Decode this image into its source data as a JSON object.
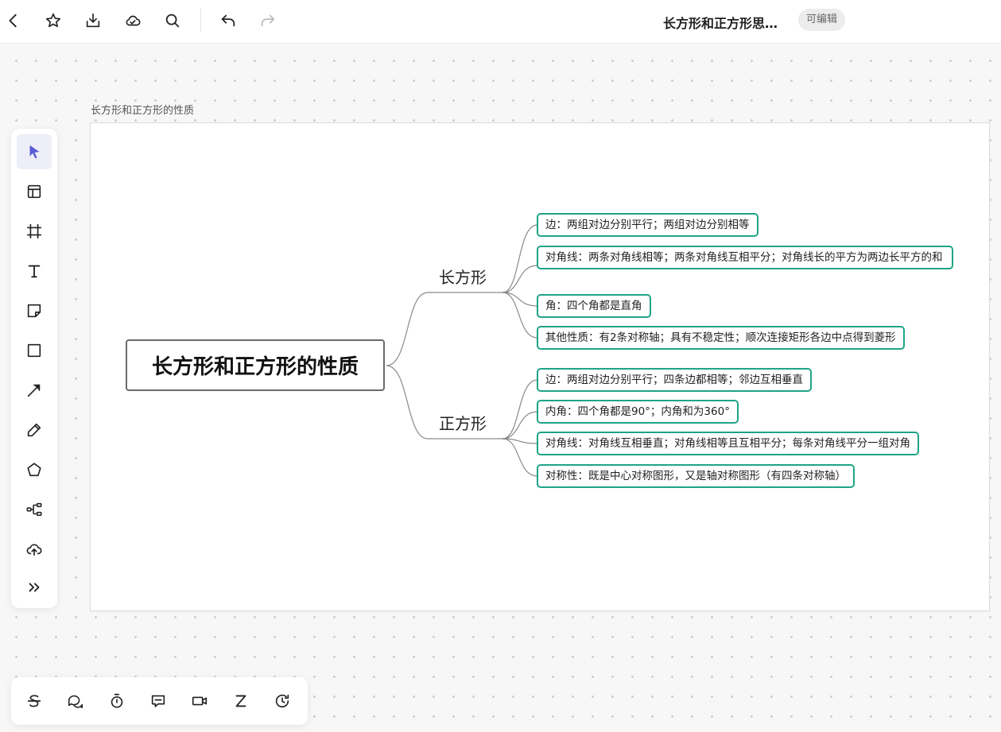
{
  "header": {
    "doc_title": "长方形和正方形思…",
    "edit_badge": "可编辑",
    "icons": [
      "back-icon",
      "star-icon",
      "download-icon",
      "cloud-icon",
      "search-icon",
      "undo-icon",
      "redo-icon"
    ]
  },
  "canvas": {
    "label": "长方形和正方形的性质"
  },
  "left_toolbar": {
    "tools": [
      "select-icon",
      "template-icon",
      "frame-icon",
      "text-icon",
      "sticky-note-icon",
      "rectangle-icon",
      "arrow-icon",
      "pen-icon",
      "pentagon-icon",
      "mindmap-icon",
      "upload-icon",
      "more-icon"
    ],
    "active_tool": "select-icon",
    "accent_color": "#5b5bd6"
  },
  "bottom_toolbar": {
    "tools": [
      "strikethrough-icon",
      "comment-icon",
      "timer-icon",
      "chat-icon",
      "video-icon",
      "z-icon",
      "history-icon"
    ]
  },
  "mindmap": {
    "central": "长方形和正方形的性质",
    "branches": [
      {
        "label": "长方形",
        "leaves": [
          "边：两组对边分别平行；两组对边分别相等",
          "对角线：两条对角线相等；两条对角线互相平分；对角线长的平方为两边长平方的和",
          "角：四个角都是直角",
          "其他性质：有2条对称轴；具有不稳定性；顺次连接矩形各边中点得到菱形"
        ]
      },
      {
        "label": "正方形",
        "leaves": [
          "边：两组对边分别平行；四条边都相等；邻边互相垂直",
          "内角：四个角都是90°；内角和为360°",
          "对角线：对角线互相垂直；对角线相等且互相平分；每条对角线平分一组对角",
          "对称性：既是中心对称图形，又是轴对称图形（有四条对称轴）"
        ]
      }
    ],
    "leaf_border_color": "#1fa487",
    "line_color": "#888888"
  }
}
